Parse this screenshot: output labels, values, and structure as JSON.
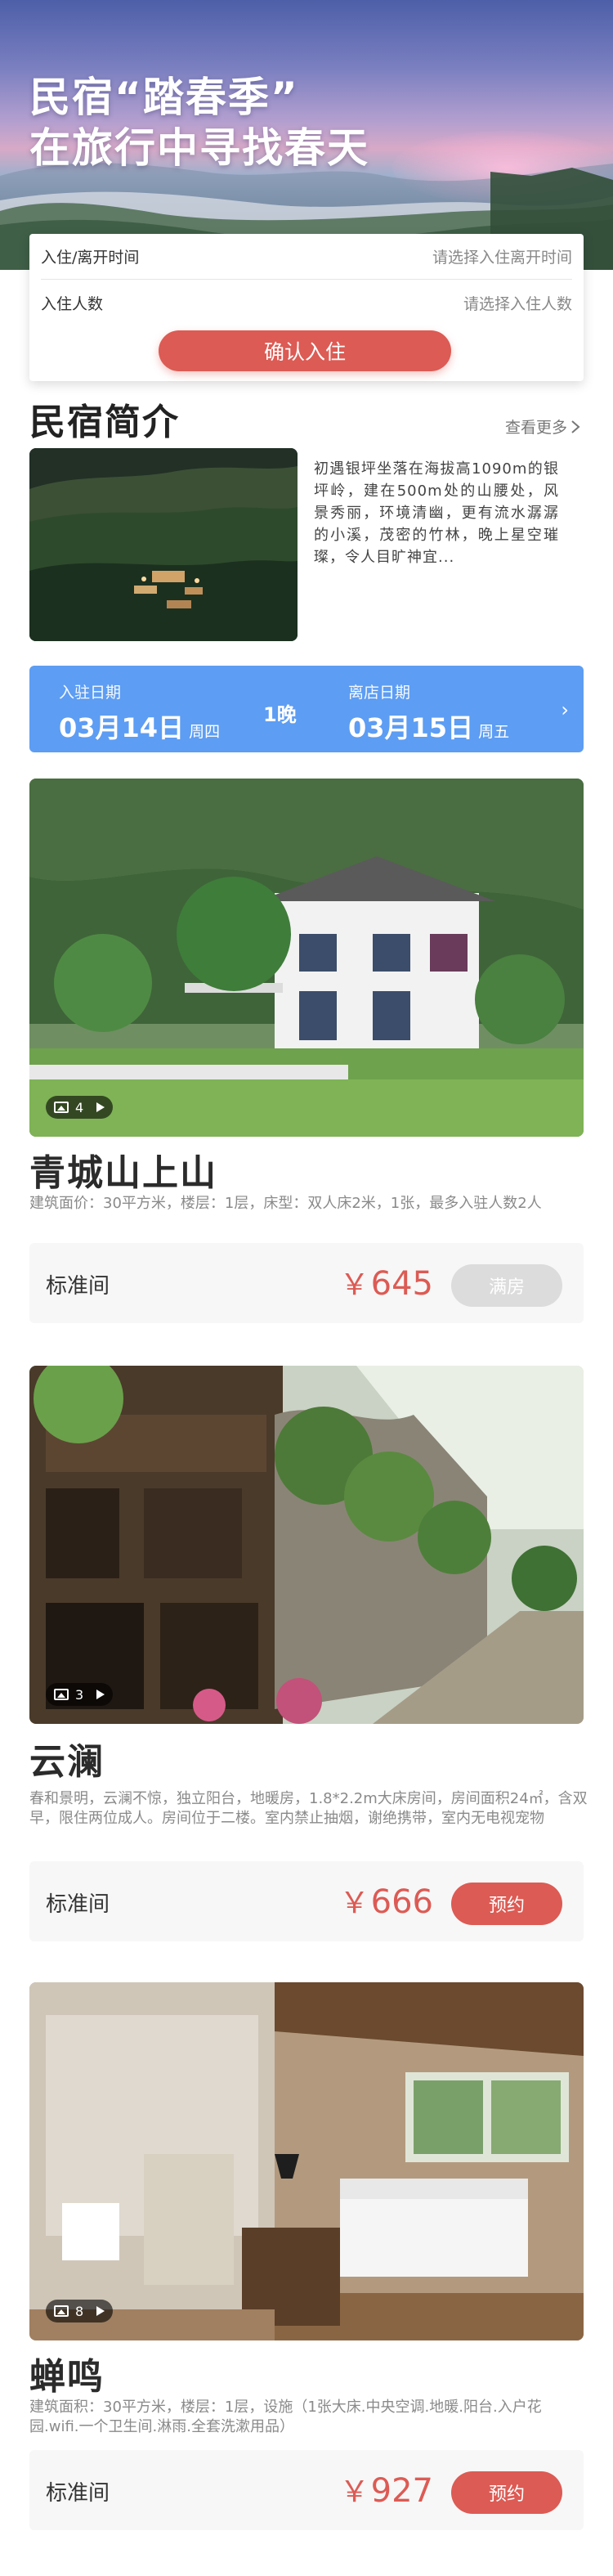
{
  "hero": {
    "title_line1": "民宿“踏春季”",
    "title_line2": "在旅行中寻找春天"
  },
  "form": {
    "checkin_label": "入住/离开时间",
    "checkin_placeholder": "请选择入住离开时间",
    "guests_label": "入住人数",
    "guests_placeholder": "请选择入住人数",
    "confirm_label": "确认入住"
  },
  "intro": {
    "title": "民宿简介",
    "see_more": "查看更多",
    "text": "初遇银坪坐落在海拔高1090m的银坪岭，建在500m处的山腰处，风景秀丽，环境清幽，更有流水潺潺的小溪，茂密的竹林，晚上星空璀璨，令人目旷神宜..."
  },
  "dates": {
    "checkin_caption": "入驻日期",
    "checkin_date": "03月14日",
    "checkin_weekday": "周四",
    "nights": "1晚",
    "checkout_caption": "离店日期",
    "checkout_date": "03月15日",
    "checkout_weekday": "周五",
    "chevron": "›"
  },
  "listings": [
    {
      "photo_count": "4",
      "name": "青城山上山",
      "desc": "建筑面价：30平方米，楼层：1层，床型：双人床2米，1张，最多入驻人数2人",
      "room_type": "标准间",
      "currency": "￥",
      "price": "645",
      "action": "满房",
      "action_state": "full"
    },
    {
      "photo_count": "3",
      "name": "云澜",
      "desc": "春和景明，云澜不惊，独立阳台，地暖房，1.8*2.2m大床房间，房间面积24㎡，含双早，限住两位成人。房间位于二楼。室内禁止抽烟，谢绝携带，室内无电视宠物",
      "room_type": "标准间",
      "currency": "￥",
      "price": "666",
      "action": "预约",
      "action_state": "available"
    },
    {
      "photo_count": "8",
      "name": "蝉鸣",
      "desc": "建筑面积：30平方米，楼层：1层，设施（1张大床.中央空调.地暖.阳台.入户花园.wifi.一个卫生间.淋雨.全套洗漱用品）",
      "room_type": "标准间",
      "currency": "￥",
      "price": "927",
      "action": "预约",
      "action_state": "available"
    }
  ],
  "colors": {
    "accent_red": "#dc5b54",
    "date_blue": "#5d9df3",
    "disabled_gray": "#dcdcdc"
  }
}
